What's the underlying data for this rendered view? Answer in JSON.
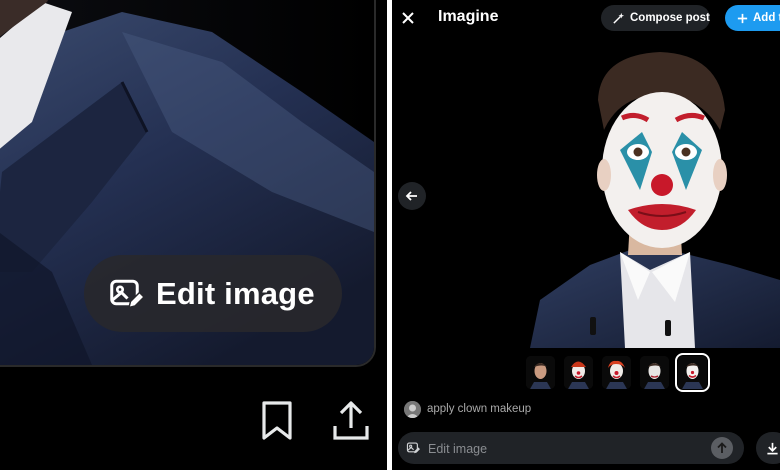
{
  "left": {
    "edit_label": "Edit image",
    "icons": {
      "image_edit": "image-edit-icon",
      "bookmark": "bookmark-icon",
      "share": "share-icon"
    }
  },
  "right": {
    "title": "Imagine",
    "compose_label": "Compose post",
    "add_label": "Add t",
    "prompt_text": "apply clown makeup",
    "input_placeholder": "Edit image",
    "thumbnail_count": 5,
    "selected_thumbnail": 5,
    "icons": {
      "close": "close-icon",
      "compose": "compose-sparkle-icon",
      "add": "add-icon",
      "back": "arrow-left-icon",
      "input": "image-edit-icon",
      "send": "arrow-up-icon",
      "download": "download-icon"
    }
  },
  "colors": {
    "background": "#000000",
    "accent": "#1d9bf0",
    "pill": "#202327",
    "muted_text": "#a9a9a9"
  }
}
